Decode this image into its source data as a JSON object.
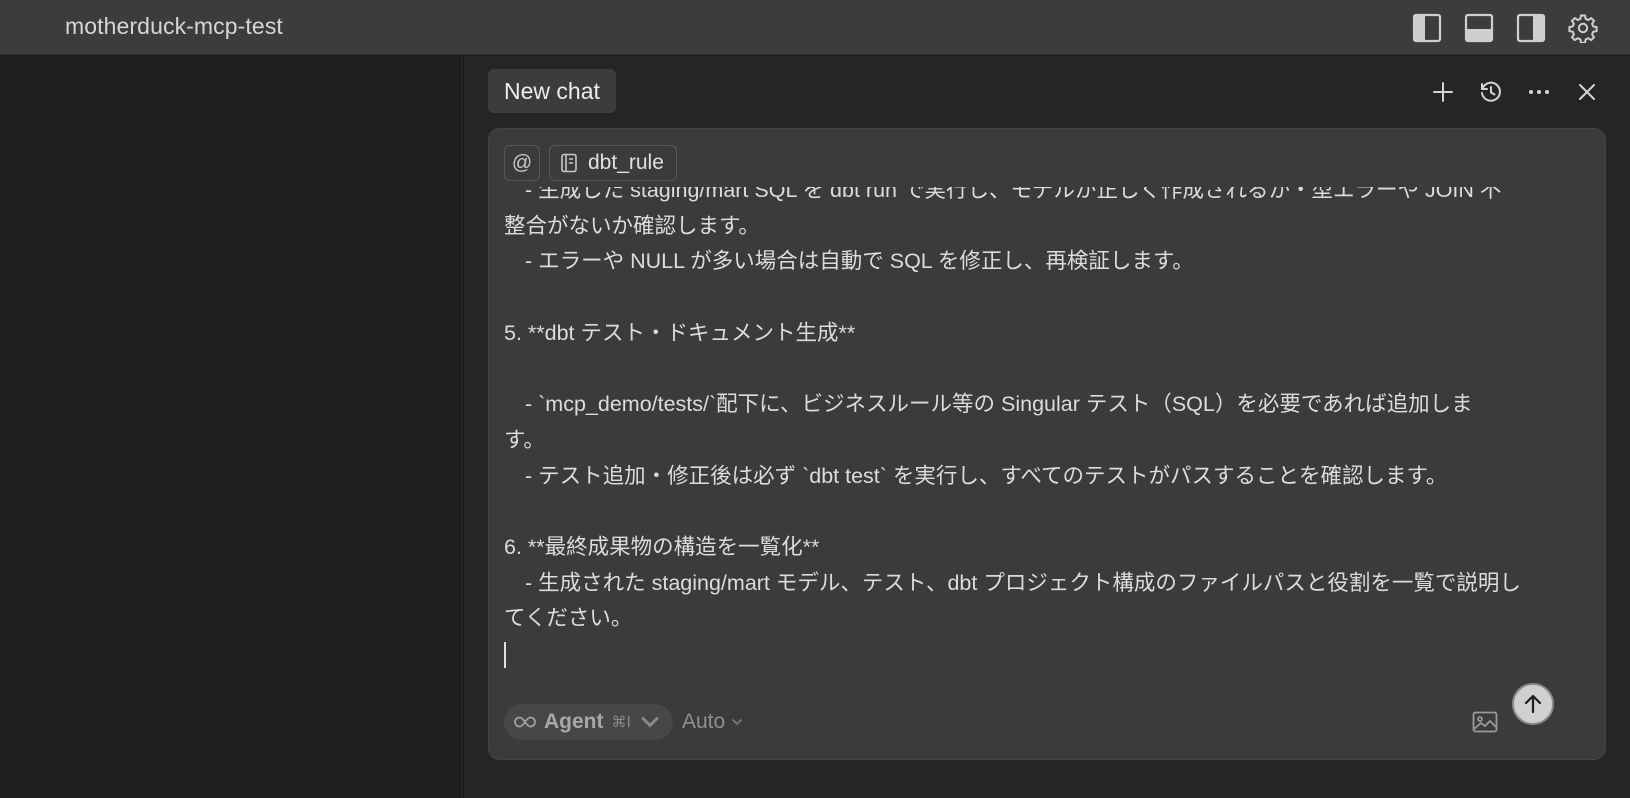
{
  "window": {
    "title": "motherduck-mcp-test",
    "toolbar_icons": [
      "toggle-primary-sidebar-icon",
      "toggle-panel-icon",
      "toggle-secondary-sidebar-icon",
      "settings-gear-icon"
    ]
  },
  "chat": {
    "tab_label": "New chat",
    "header_icons": [
      "new-chat-plus-icon",
      "history-icon",
      "more-actions-icon",
      "close-icon"
    ],
    "context": {
      "mention_symbol": "@",
      "file_chip_label": "dbt_rule"
    },
    "message_lines": [
      "- 生成した staging/mart SQL を dbt run で実行し、モデルが正しく作成されるか・型エラーや JOIN 不",
      "整合がないか確認します。",
      "- エラーや NULL が多い場合は自動で SQL を修正し、再検証します。",
      "",
      "5. **dbt テスト・ドキュメント生成**",
      "",
      "- `mcp_demo/tests/`配下に、ビジネスルール等の Singular テスト（SQL）を必要であれば追加しま",
      "す。",
      "- テスト追加・修正後は必ず `dbt test` を実行し、すべてのテストがパスすることを確認します。",
      "",
      "6. **最終成果物の構造を一覧化**",
      "- 生成された staging/mart モデル、テスト、dbt プロジェクト構成のファイルパスと役割を一覧で説明し",
      "てください。"
    ],
    "mode": {
      "label": "Agent",
      "shortcut": "⌘I"
    },
    "model_selector": "Auto"
  },
  "colors": {
    "titlebar": "#3c3c3c",
    "chat_background": "#252526",
    "composer_background": "#3b3b3b",
    "left_pane": "#1e1e1e"
  }
}
